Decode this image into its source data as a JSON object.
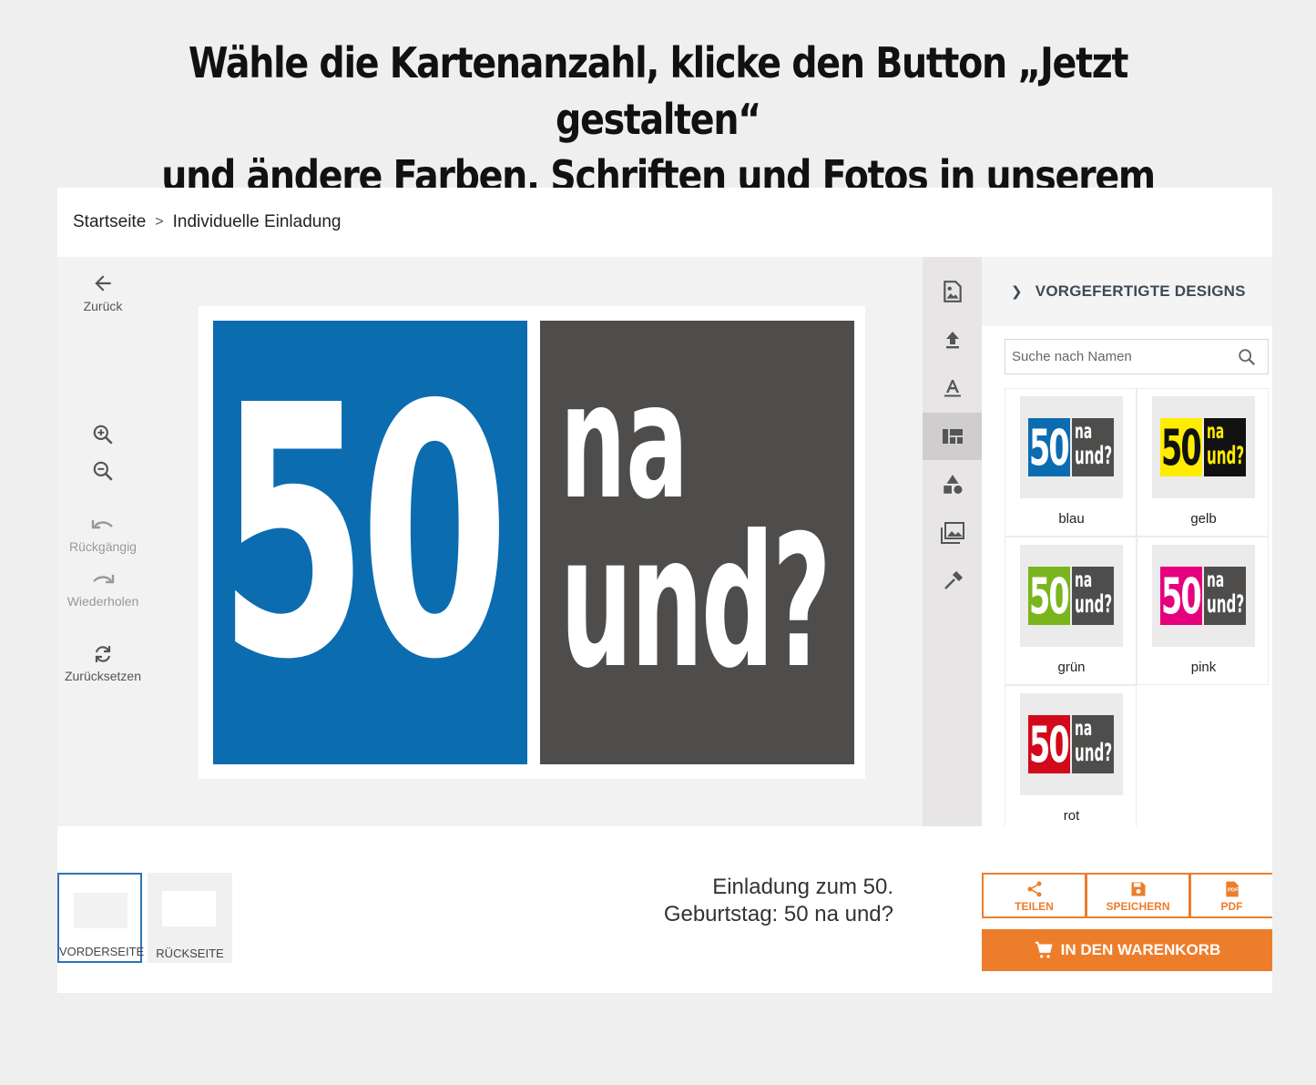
{
  "headline": {
    "line1": "Wähle die Kartenanzahl, klicke den Button „Jetzt gestalten“",
    "line2": "und ändere Farben, Schriften und Fotos in unserem Editor!"
  },
  "breadcrumb": {
    "items": [
      "Startseite",
      "Individuelle Einladung"
    ],
    "separator": ">"
  },
  "tools": {
    "back": "Zurück",
    "undo": "Rückgängig",
    "redo": "Wiederholen",
    "reset": "Zurücksetzen"
  },
  "card": {
    "left_text": "50",
    "right_line1": "na",
    "right_line2": "und?",
    "left_color": "#0c6cb0",
    "right_color": "#4e4d4c"
  },
  "iconbar": {
    "items": [
      "image-edit-icon",
      "upload-icon",
      "text-icon",
      "layout-icon",
      "shapes-icon",
      "gallery-icon",
      "eyedropper-icon"
    ],
    "active": "layout-icon"
  },
  "sidepanel": {
    "title": "VORGEFERTIGTE DESIGNS",
    "search_placeholder": "Suche nach Namen",
    "designs": [
      {
        "name": "blau",
        "left_color": "#0c6cb0",
        "text_color": "#ffffff",
        "right_text_color": "#ffffff",
        "right_color": "#4e4d4c"
      },
      {
        "name": "gelb",
        "left_color": "#ffed00",
        "text_color": "#111111",
        "right_text_color": "#ffed00",
        "right_color": "#111111"
      },
      {
        "name": "grün",
        "left_color": "#7ab51d",
        "text_color": "#ffffff",
        "right_text_color": "#ffffff",
        "right_color": "#4e4d4c"
      },
      {
        "name": "pink",
        "left_color": "#e5007e",
        "text_color": "#ffffff",
        "right_text_color": "#ffffff",
        "right_color": "#4e4d4c"
      },
      {
        "name": "rot",
        "left_color": "#d2091b",
        "text_color": "#ffffff",
        "right_text_color": "#ffffff",
        "right_color": "#4e4d4c"
      }
    ],
    "number": "50",
    "line1": "na",
    "line2": "und?"
  },
  "pages": {
    "front": "VORDERSEITE",
    "back": "RÜCKSEITE",
    "active": "front"
  },
  "product": {
    "title_line1": "Einladung zum 50.",
    "title_line2": "Geburtstag: 50 na und?"
  },
  "actions": {
    "share": "TEILEN",
    "save": "SPEICHERN",
    "pdf": "PDF",
    "pdf_icon_text": "PDF",
    "cart": "IN DEN WARENKORB",
    "accent_color": "#ee7d2b"
  }
}
